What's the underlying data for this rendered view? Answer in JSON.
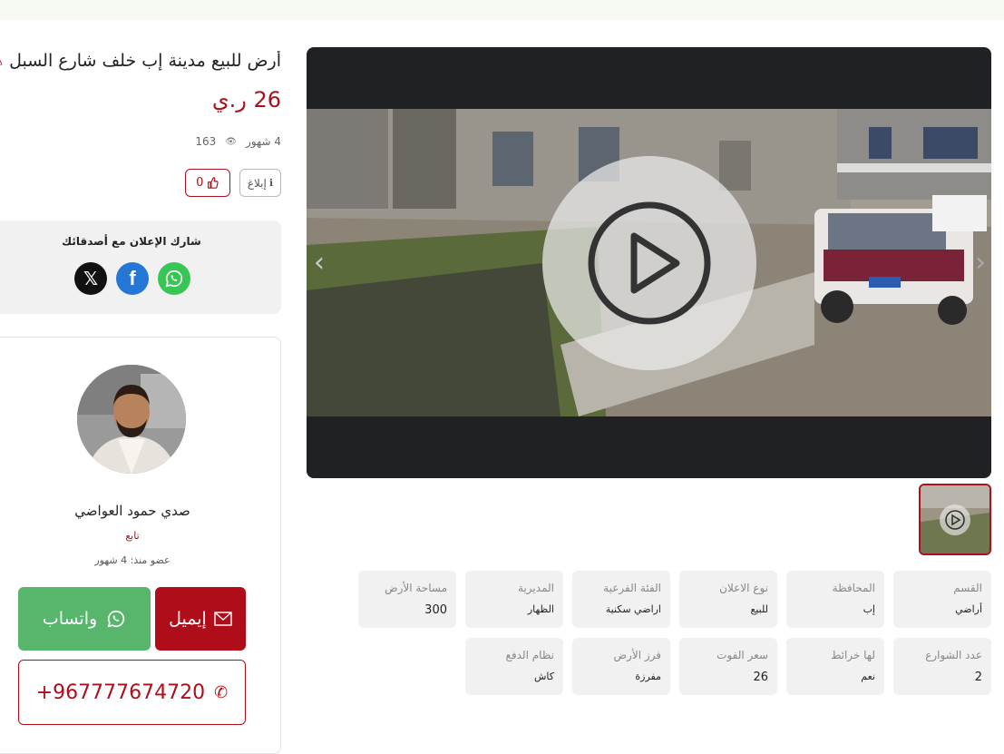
{
  "listing": {
    "title": "أرض للبيع مدينة إب خلف شارع السبل",
    "price": "26 ر.ي",
    "age": "4 شهور",
    "views": "163",
    "report_label": "إبلاغ",
    "likes": "0"
  },
  "share": {
    "title": "شارك الإعلان مع أصدقائك"
  },
  "seller": {
    "name": "صدي حمود العواضي",
    "follow_label": "تابع",
    "member_since": "عضو منذ: 4 شهور",
    "email_label": "إيميل",
    "whatsapp_label": "واتساب",
    "phone": "+967777674720"
  },
  "specs": [
    {
      "label": "القسم",
      "value": "أراضي"
    },
    {
      "label": "المحافظة",
      "value": "إب"
    },
    {
      "label": "نوع الاعلان",
      "value": "للبيع"
    },
    {
      "label": "الفئة الفرعية",
      "value": "اراضي سكنية"
    },
    {
      "label": "المديرية",
      "value": "الظهار"
    },
    {
      "label": "مساحة الأرض",
      "value": "300"
    },
    {
      "label": "عدد الشوارع",
      "value": "2"
    },
    {
      "label": "لها خرائط",
      "value": "نعم"
    },
    {
      "label": "سعر الفوت",
      "value": "26"
    },
    {
      "label": "فرز الأرض",
      "value": "مفرزة"
    },
    {
      "label": "نظام الدفع",
      "value": "كاش"
    }
  ],
  "colors": {
    "brand": "#a8111d",
    "whatsapp": "#57b66b",
    "facebook": "#2477d4",
    "x": "#111111"
  }
}
